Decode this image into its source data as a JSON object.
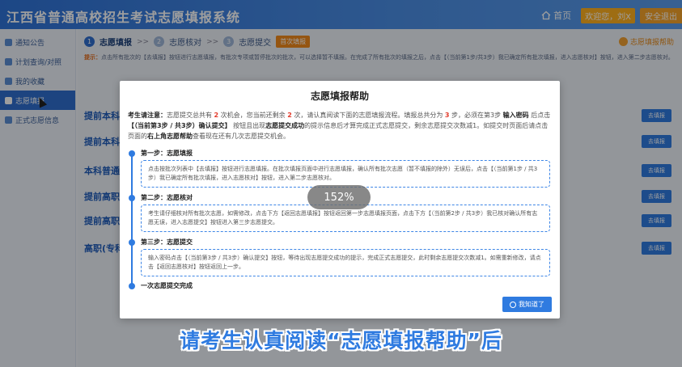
{
  "header": {
    "title": "江西省普通高校招生考试志愿填报系统",
    "home_label": "首页",
    "welcome_label": "欢迎您，刘X",
    "logout_label": "安全退出"
  },
  "sidebar": {
    "items": [
      {
        "label": "通知公告",
        "active": false
      },
      {
        "label": "计划查询/对照",
        "active": false
      },
      {
        "label": "我的收藏",
        "active": false
      },
      {
        "label": "志愿填报",
        "active": true
      },
      {
        "label": "正式志愿信息",
        "active": false
      }
    ]
  },
  "steps": {
    "items": [
      {
        "num": "1",
        "label": "志愿填报",
        "active": true
      },
      {
        "num": "2",
        "label": "志愿核对",
        "active": false
      },
      {
        "num": "3",
        "label": "志愿提交",
        "active": false
      }
    ],
    "separator": ">>",
    "first_badge": "首次填报",
    "help_link": "志愿填报帮助"
  },
  "tip": {
    "label": "提示：",
    "text": "点击所有批次的【去填报】按钮进行志愿填报，有批次专项或暂停批次的批次，可以选择暂不填报。在完成了所有批次的填报之后，点击【（当前第1步/共3步）我已确定所有批次填报，进入志愿核对】按钮，进入第二步志愿核对。"
  },
  "sections": [
    {
      "title": "提前本科",
      "button": "去填报"
    },
    {
      "title": "提前本科",
      "button": "去填报"
    },
    {
      "title": "本科普通",
      "button": "去填报"
    },
    {
      "title": "提前高职",
      "button": "去填报"
    },
    {
      "title": "提前高职",
      "button": "去填报"
    },
    {
      "title": "高职(专科)",
      "button": "去填报"
    }
  ],
  "modal": {
    "title": "志愿填报帮助",
    "intro_label": "考生请注意：",
    "intro_a": "志愿提交总共有 ",
    "intro_total": "2",
    "intro_b": " 次机会，您当前还剩余 ",
    "intro_left": "2",
    "intro_c": " 次，请认真阅读下面的志愿填报流程。填报总共分为 ",
    "intro_steps": "3",
    "intro_d": " 步，必须在第3步 ",
    "intro_pwd": "输入密码",
    "intro_e": " 后点击 ",
    "intro_confirm": "【（当前第3步 / 共3步）确认提交】",
    "intro_f": " 按钮且出现",
    "intro_success": "志愿提交成功",
    "intro_g": "的提示信息后才算完成正式志愿提交，剩余志愿提交次数减1。如提交时页面后请点击页面的",
    "intro_corner": "右上角志愿帮助",
    "intro_h": "查看现在还有几次志愿提交机会。",
    "steps": [
      {
        "head": "第一步：志愿填报",
        "body": "点击按批次列表中【去填报】按钮进行志愿填报。在批次填报页面中进行志愿填报，确认所有批次志愿（暂不填报的除外）无误后，点击【（当前第1步 / 共3步）我已确定所有批次填报，进入志愿核对】按钮，进入第二步志愿核对。"
      },
      {
        "head": "第二步：志愿核对",
        "body": "考生请仔细核对所有批次志愿，如需修改，点击下方【返回志愿填报】按钮返回第一步志愿填报页面，点击下方【（当前第2步 / 共3步）我已核对确认所有志愿无误，进入志愿提交】按钮进入第三步志愿提交。"
      },
      {
        "head": "第三步：志愿提交",
        "body": "输入密码点击【（当前第3步 / 共3步）确认提交】按钮，等待出现志愿提交成功的提示，完成正式志愿提交，此时剩余志愿提交次数减1。如需重新修改，请点击【返回志愿核对】按钮返回上一步。"
      }
    ],
    "final_step": "一次志愿提交完成",
    "ok_button": "我知道了"
  },
  "zoom": "152%",
  "caption": "请考生认真阅读“志愿填报帮助”后"
}
